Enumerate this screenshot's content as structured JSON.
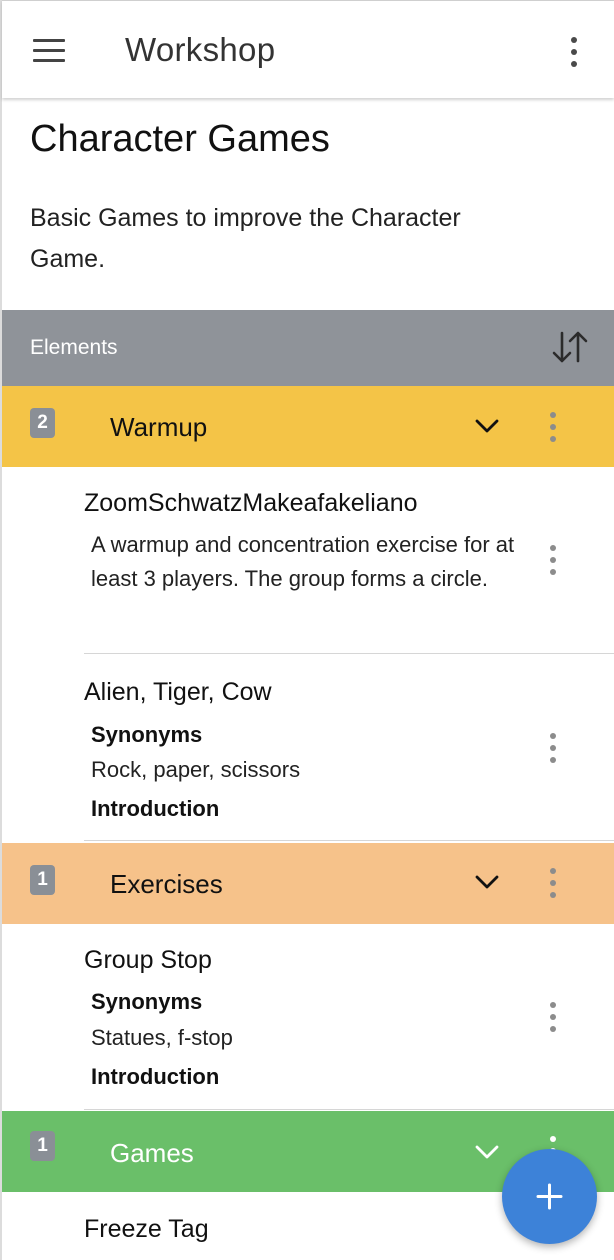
{
  "colors": {
    "appbar_bg": "#ffffff",
    "elements_bar": "#8f9399",
    "warmup": "#f4c447",
    "exercises": "#f6c28a",
    "games": "#6abf69",
    "badge": "#8a8f96",
    "fab": "#3d82d8"
  },
  "appbar": {
    "title": "Workshop",
    "menu_icon": "hamburger-icon",
    "overflow_icon": "more-vert-icon"
  },
  "header": {
    "title": "Character Games",
    "description": "Basic Games to improve the Character Game."
  },
  "elements_bar": {
    "label": "Elements",
    "sort_icon": "sort-arrows-icon"
  },
  "sections": [
    {
      "count": "2",
      "label": "Warmup",
      "items": [
        {
          "title": "ZoomSchwatzMakeafakeliano",
          "description": "A warmup and concentration exercise for at least 3 players. The group forms a circle."
        },
        {
          "title": "Alien, Tiger, Cow",
          "synonyms_label": "Synonyms",
          "synonyms": "Rock, paper, scissors",
          "introduction_label": "Introduction"
        }
      ]
    },
    {
      "count": "1",
      "label": "Exercises",
      "items": [
        {
          "title": "Group Stop",
          "synonyms_label": "Synonyms",
          "synonyms": "Statues, f-stop",
          "introduction_label": "Introduction"
        }
      ]
    },
    {
      "count": "1",
      "label": "Games",
      "items": [
        {
          "title": "Freeze Tag"
        }
      ]
    }
  ],
  "fab": {
    "icon": "add-icon"
  }
}
